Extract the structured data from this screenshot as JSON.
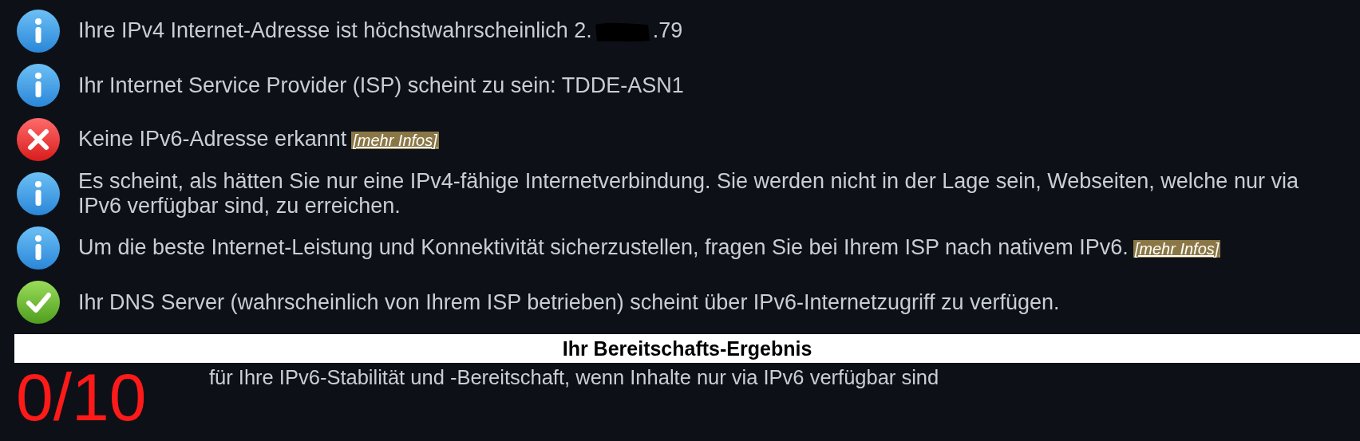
{
  "messages": [
    {
      "kind": "info",
      "text": "Ihre IPv4 Internet-Adresse ist höchstwahrscheinlich 2.",
      "redacted": true,
      "text_after": ".79"
    },
    {
      "kind": "info",
      "text": "Ihr Internet Service Provider (ISP) scheint zu sein: TDDE-ASN1"
    },
    {
      "kind": "error",
      "text": "Keine IPv6-Adresse erkannt",
      "link": "[mehr Infos]"
    },
    {
      "kind": "info",
      "text": "Es scheint, als hätten Sie nur eine IPv4-fähige Internetverbindung. Sie werden nicht in der Lage sein, Webseiten, welche nur via IPv6 verfügbar sind, zu erreichen."
    },
    {
      "kind": "info",
      "text": "Um die beste Internet-Leistung und Konnektivität sicherzustellen, fragen Sie bei Ihrem ISP nach nativem IPv6.",
      "link": "[mehr Infos]"
    },
    {
      "kind": "ok",
      "text": "Ihr DNS Server (wahrscheinlich von Ihrem ISP betrieben) scheint über IPv6-Internetzugriff zu verfügen."
    }
  ],
  "result": {
    "heading": "Ihr Bereitschafts-Ergebnis",
    "score": "0/10",
    "description": "für Ihre IPv6-Stabilität und -Bereitschaft, wenn Inhalte nur via IPv6 verfügbar sind"
  }
}
